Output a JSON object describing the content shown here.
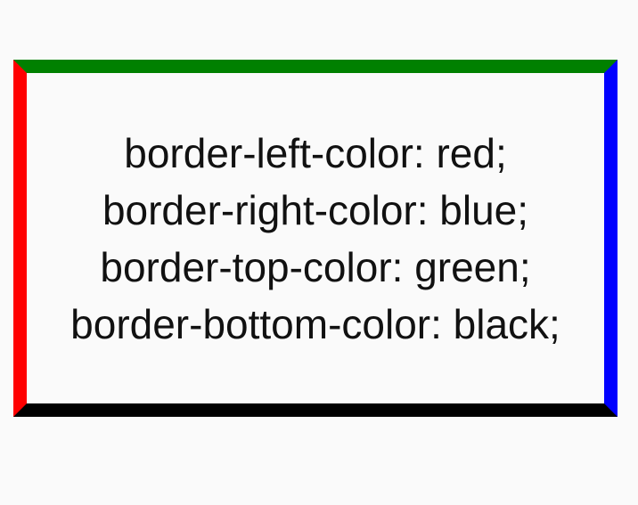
{
  "box": {
    "lines": [
      "border-left-color: red;",
      "border-right-color: blue;",
      "border-top-color: green;",
      "border-bottom-color: black;"
    ],
    "colors": {
      "left": "#ff0000",
      "right": "#0000ff",
      "top": "#008000",
      "bottom": "#000000"
    }
  }
}
